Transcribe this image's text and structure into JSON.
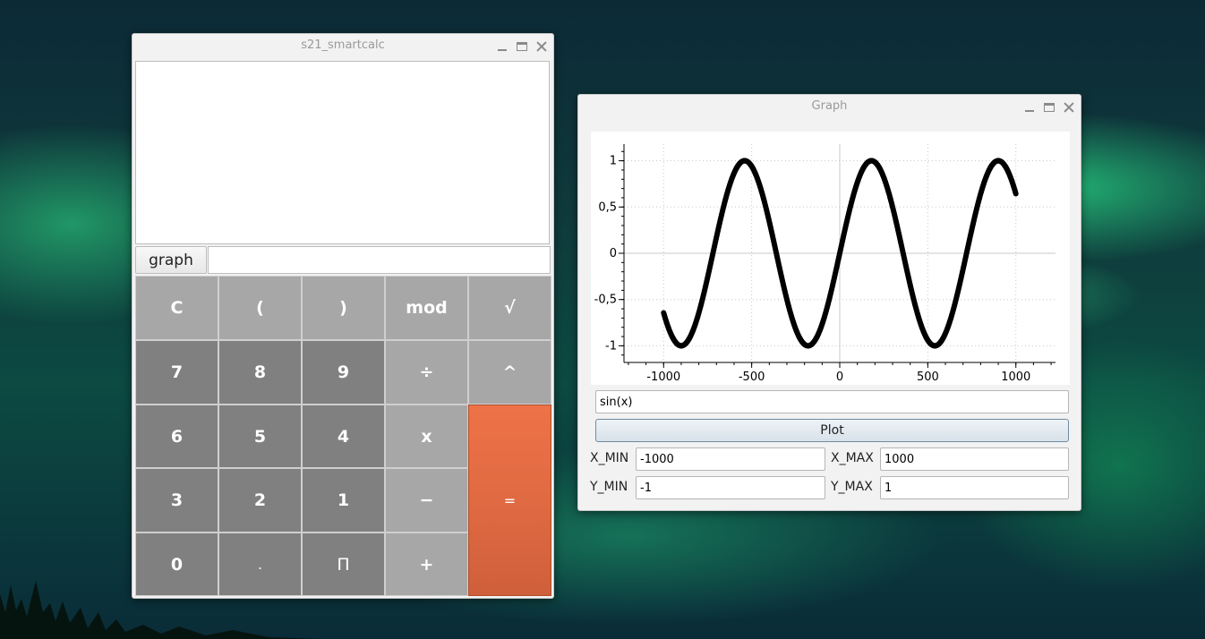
{
  "calculator": {
    "title": "s21_smartcalc",
    "graph_button": "graph",
    "x_value": "",
    "keys": {
      "clear": "C",
      "lparen": "(",
      "rparen": ")",
      "mod": "mod",
      "sqrt": "√",
      "seven": "7",
      "eight": "8",
      "nine": "9",
      "divide": "÷",
      "power": "^",
      "six": "6",
      "five": "5",
      "four": "4",
      "multiply": "x",
      "equals": "=",
      "three": "3",
      "two": "2",
      "one": "1",
      "minus": "−",
      "zero": "0",
      "dot": ".",
      "pi": "Π",
      "plus": "+"
    }
  },
  "graph": {
    "title": "Graph",
    "function": "sin(x)",
    "plot_button": "Plot",
    "x_min_label": "X_MIN",
    "x_min": "-1000",
    "x_max_label": "X_MAX",
    "x_max": "1000",
    "y_min_label": "Y_MIN",
    "y_min": "-1",
    "y_max_label": "Y_MAX",
    "y_max": "1"
  },
  "chart_data": {
    "type": "scatter",
    "expression": "sin(x)",
    "xlim": [
      -1000,
      1000
    ],
    "ylim": [
      -1,
      1
    ],
    "x_ticks": [
      "-1000",
      "-500",
      "0",
      "500",
      "1000"
    ],
    "y_ticks": [
      "1",
      "0,5",
      "0",
      "-0,5",
      "-1"
    ],
    "grid": true,
    "color": "#000000"
  }
}
